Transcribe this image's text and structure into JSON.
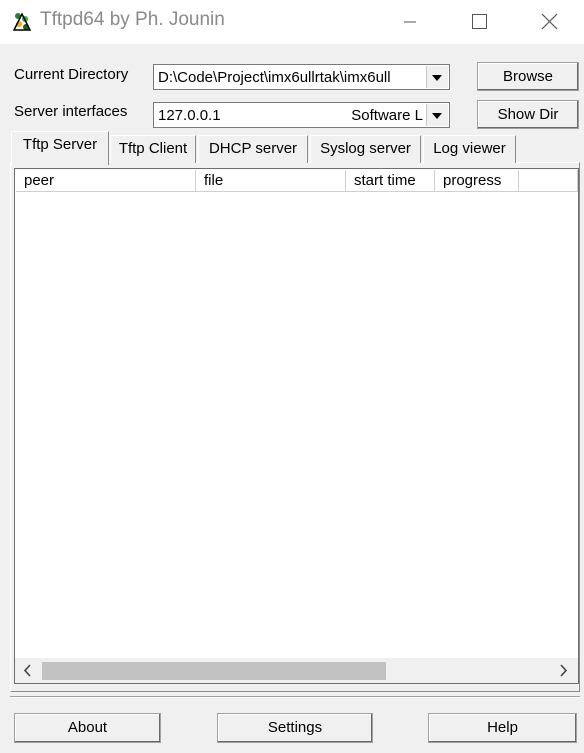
{
  "window": {
    "title": "Tftpd64 by Ph. Jounin",
    "icon": "tftpd64-app-icon",
    "controls": [
      "minimize-icon",
      "maximize-icon",
      "close-icon"
    ]
  },
  "settings": {
    "current_directory_label": "Current Directory",
    "current_directory_value": "D:\\Code\\Project\\imx6ullrtak\\imx6ull",
    "server_interfaces_label": "Server interfaces",
    "server_interfaces_ip": "127.0.0.1",
    "server_interfaces_name": "Software L",
    "browse_label": "Browse",
    "show_dir_label": "Show Dir"
  },
  "tabs": [
    {
      "label": "Tftp Server",
      "active": true
    },
    {
      "label": "Tftp Client",
      "active": false
    },
    {
      "label": "DHCP server",
      "active": false
    },
    {
      "label": "Syslog server",
      "active": false
    },
    {
      "label": "Log viewer",
      "active": false
    }
  ],
  "transfers": {
    "columns": [
      "peer",
      "file",
      "start time",
      "progress",
      ""
    ],
    "rows": []
  },
  "footer": {
    "about_label": "About",
    "settings_label": "Settings",
    "help_label": "Help"
  }
}
